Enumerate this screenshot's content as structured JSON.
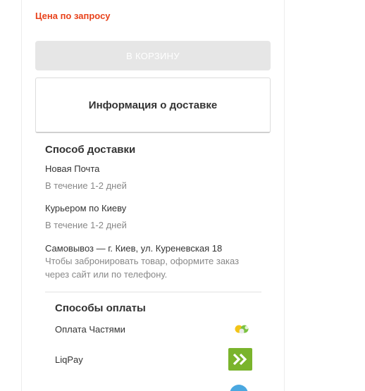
{
  "price_note": "Цена по запросу",
  "cart_button": "В КОРЗИНУ",
  "delivery_info": {
    "title": "Информация о доставке"
  },
  "delivery": {
    "title": "Способ доставки",
    "nova_poshta": {
      "name": "Новая Почта",
      "term": "В течение 1-2 дней"
    },
    "courier": {
      "name": "Курьером по Киеву",
      "term": "В течение 1-2 дней"
    },
    "pickup": {
      "line1": "Самовывоз — г. Киев, ул. Куреневская 18",
      "line2": "Чтобы забронировать товар, оформите заказ",
      "line3": "через сайт или по телефону."
    }
  },
  "payment": {
    "title": "Способы оплаты",
    "methods": [
      {
        "label": "Оплата Частями",
        "icon": "privatbank-parts-icon"
      },
      {
        "label": "LiqPay",
        "icon": "liqpay-icon"
      }
    ]
  },
  "colors": {
    "accent": "#e8421b",
    "liqpay": "#7ab42c",
    "disabled_button": "#e6e6e6"
  }
}
